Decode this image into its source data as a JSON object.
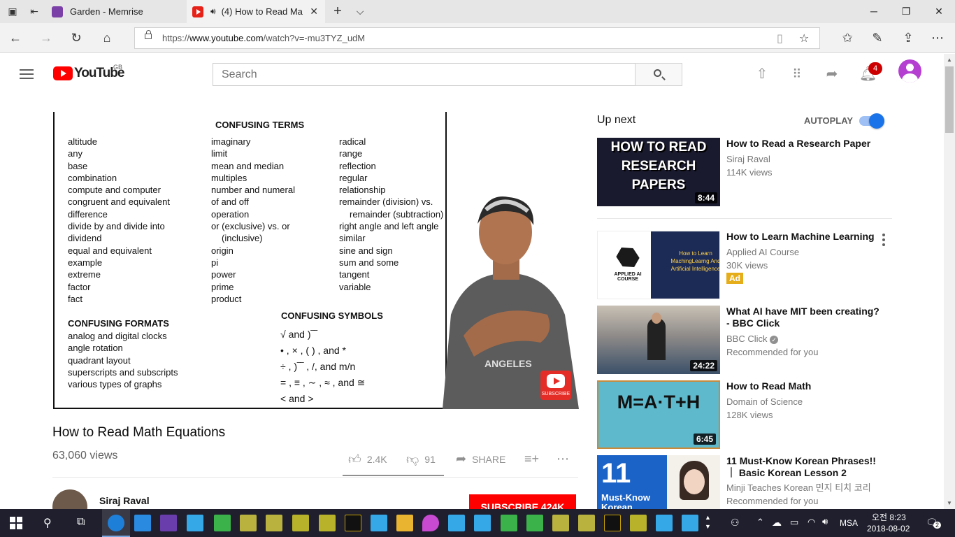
{
  "browser": {
    "tabs": [
      {
        "label": "Garden - Memrise"
      },
      {
        "label": "(4) How to Read Ma"
      }
    ],
    "url_prefix": "https://",
    "url_host": "www.youtube.com",
    "url_path": "/watch?v=-mu3TYZ_udM"
  },
  "yt_header": {
    "logo_text": "YouTube",
    "region": "GB",
    "search_placeholder": "Search",
    "notification_count": "4"
  },
  "slide": {
    "heading_terms": "CONFUSING TERMS",
    "col1": [
      "altitude",
      "any",
      "base",
      "combination",
      "compute and computer",
      "congruent and equivalent",
      "difference",
      "divide by and divide into",
      "dividend",
      "equal and equivalent",
      "example",
      "extreme",
      "factor",
      "fact"
    ],
    "col2": [
      "imaginary",
      "limit",
      "mean and median",
      "multiples",
      "number and numeral",
      "of and off",
      "operation",
      "or (exclusive) vs. or",
      "(inclusive)",
      "origin",
      "pi",
      "power",
      "prime",
      "product"
    ],
    "col3": [
      "radical",
      "range",
      "reflection",
      "regular",
      "relationship",
      "remainder (division) vs.",
      "remainder (subtraction)",
      "right angle and left angle",
      "similar",
      "sine and sign",
      "sum and some",
      "tangent",
      "variable"
    ],
    "heading_formats": "CONFUSING FORMATS",
    "formats": [
      "analog and digital clocks",
      "angle rotation",
      "quadrant layout",
      "superscripts and subscripts",
      "various types of graphs"
    ],
    "heading_symbols": "CONFUSING SYMBOLS",
    "symbols": [
      "√ and )‾‾",
      "• , × , (    ) , and *",
      "÷ , )‾‾ , /, and m/n",
      "= , ≡ , ∼ , ≈ , and ≅",
      "< and >"
    ],
    "subscribe_overlay": "SUBSCRIBE"
  },
  "video": {
    "title": "How to Read Math Equations",
    "views": "63,060 views",
    "likes": "2.4K",
    "dislikes": "91",
    "share": "SHARE",
    "like_ratio": 0.96,
    "channel": "Siraj Raval",
    "subscribe": "SUBSCRIBE  424K"
  },
  "sidebar": {
    "up_next": "Up next",
    "autoplay": "AUTOPLAY",
    "autoplay_on": true,
    "items": [
      {
        "title": "How to Read a Research Paper",
        "channel": "Siraj Raval",
        "meta": "114K views",
        "duration": "8:44",
        "thumb_text": "HOW TO READ RESEARCH PAPERS"
      },
      {
        "title": "How to Learn Machine Learning",
        "channel": "Applied AI Course",
        "meta": "30K views",
        "badge": "Ad",
        "thumb_text": "How to Learn MachingLearng And Artificial Intelligence",
        "thumb_brand": "APPLIED AI COURSE"
      },
      {
        "title": "What AI have MIT been creating? - BBC Click",
        "channel": "BBC Click",
        "meta": "Recommended for you",
        "duration": "24:22"
      },
      {
        "title": "How to Read Math",
        "channel": "Domain of Science",
        "meta": "128K views",
        "duration": "6:45",
        "thumb_text": "M=A·T+H"
      },
      {
        "title": "11 Must-Know Korean Phrases!! ｜ Basic Korean Lesson 2",
        "channel": "Minji Teaches Korean 민지 티치 코리",
        "meta": "Recommended for you",
        "thumb_text": "11",
        "thumb_sub": "Must-Know Korean"
      }
    ]
  },
  "taskbar": {
    "ime": "MSA",
    "time": "오전 8:23",
    "date": "2018-08-02",
    "notif_count": "2"
  },
  "colors": {
    "youtube_red": "#ff0000",
    "autoplay_blue": "#1a73e8",
    "ad_yellow": "#e6ad1a",
    "notification_red": "#cc0000"
  }
}
